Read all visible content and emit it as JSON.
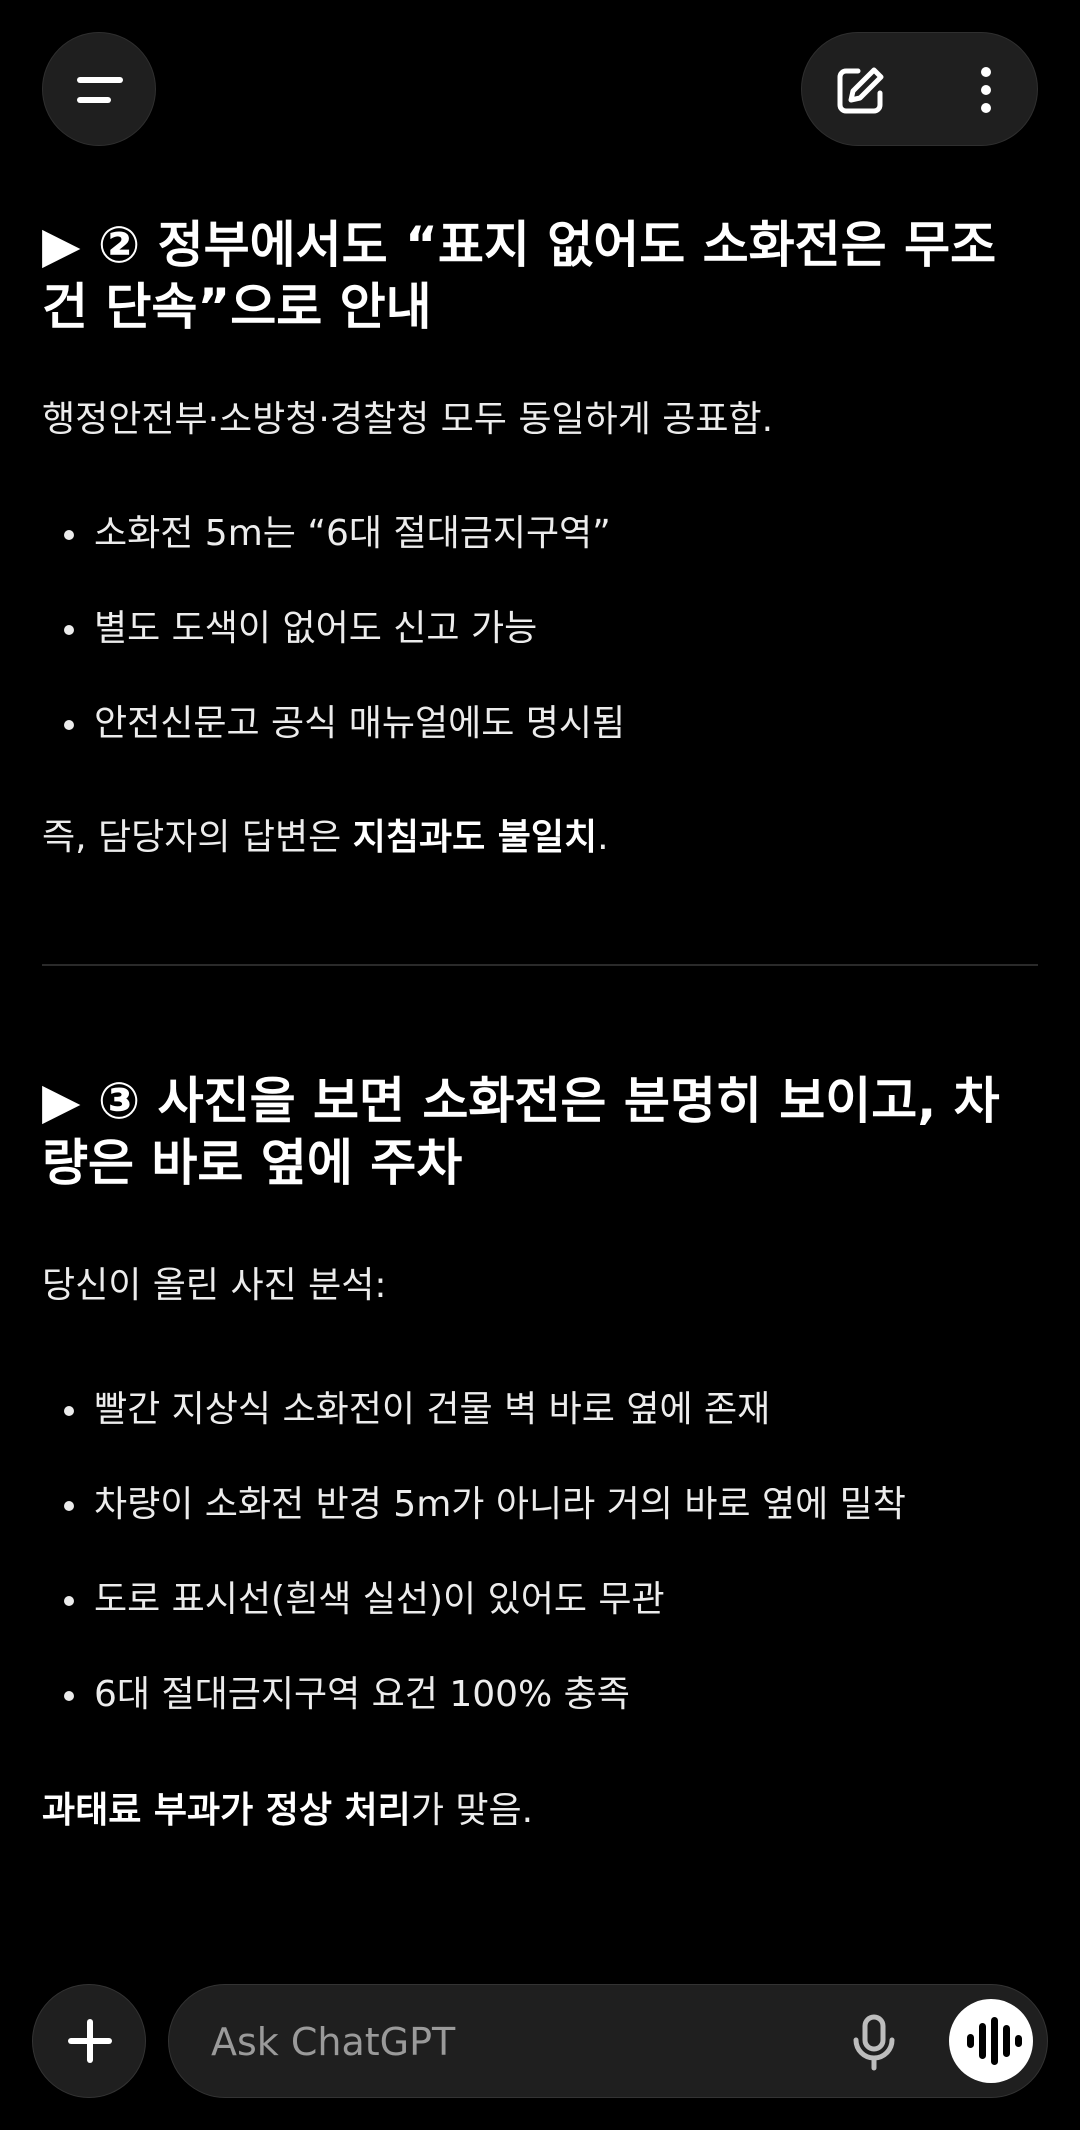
{
  "header": {
    "menu_icon": "hamburger-menu-icon",
    "edit_icon": "new-chat-pencil-icon",
    "more_icon": "more-vertical-icon"
  },
  "section1": {
    "heading": "▶ ② 정부에서도 “표지 없어도 소화전은 무조건 단속”으로 안내",
    "intro": "행정안전부·소방청·경찰청 모두 동일하게 공표함.",
    "bullets": [
      "소화전 5m는 “6대 절대금지구역”",
      "별도 도색이 없어도 신고 가능",
      "안전신문고 공식 매뉴얼에도 명시됨"
    ],
    "conclusion_prefix": "즉, 담당자의 답변은 ",
    "conclusion_bold": "지침과도 불일치",
    "conclusion_suffix": "."
  },
  "section2": {
    "heading": "▶ ③ 사진을 보면 소화전은 분명히 보이고, 차량은 바로 옆에 주차",
    "intro": "당신이 올린 사진 분석:",
    "bullets": [
      "빨간 지상식 소화전이 건물 벽 바로 옆에 존재",
      "차량이 소화전 반경 5m가 아니라 거의 바로 옆에 밀착",
      "도로 표시선(흰색 실선)이 있어도 무관",
      "6대 절대금지구역 요건 100% 충족"
    ],
    "conclusion_bold": "과태료 부과가 정상 처리",
    "conclusion_suffix": "가 맞음."
  },
  "composer": {
    "placeholder": "Ask ChatGPT",
    "plus_icon": "plus-icon",
    "mic_icon": "microphone-icon",
    "voice_icon": "voice-mode-waveform-icon"
  },
  "colors": {
    "background": "#000000",
    "surface": "#1f1f1f",
    "text": "#ececec",
    "placeholder": "#9a9a9a",
    "divider": "#2a2a2a"
  }
}
